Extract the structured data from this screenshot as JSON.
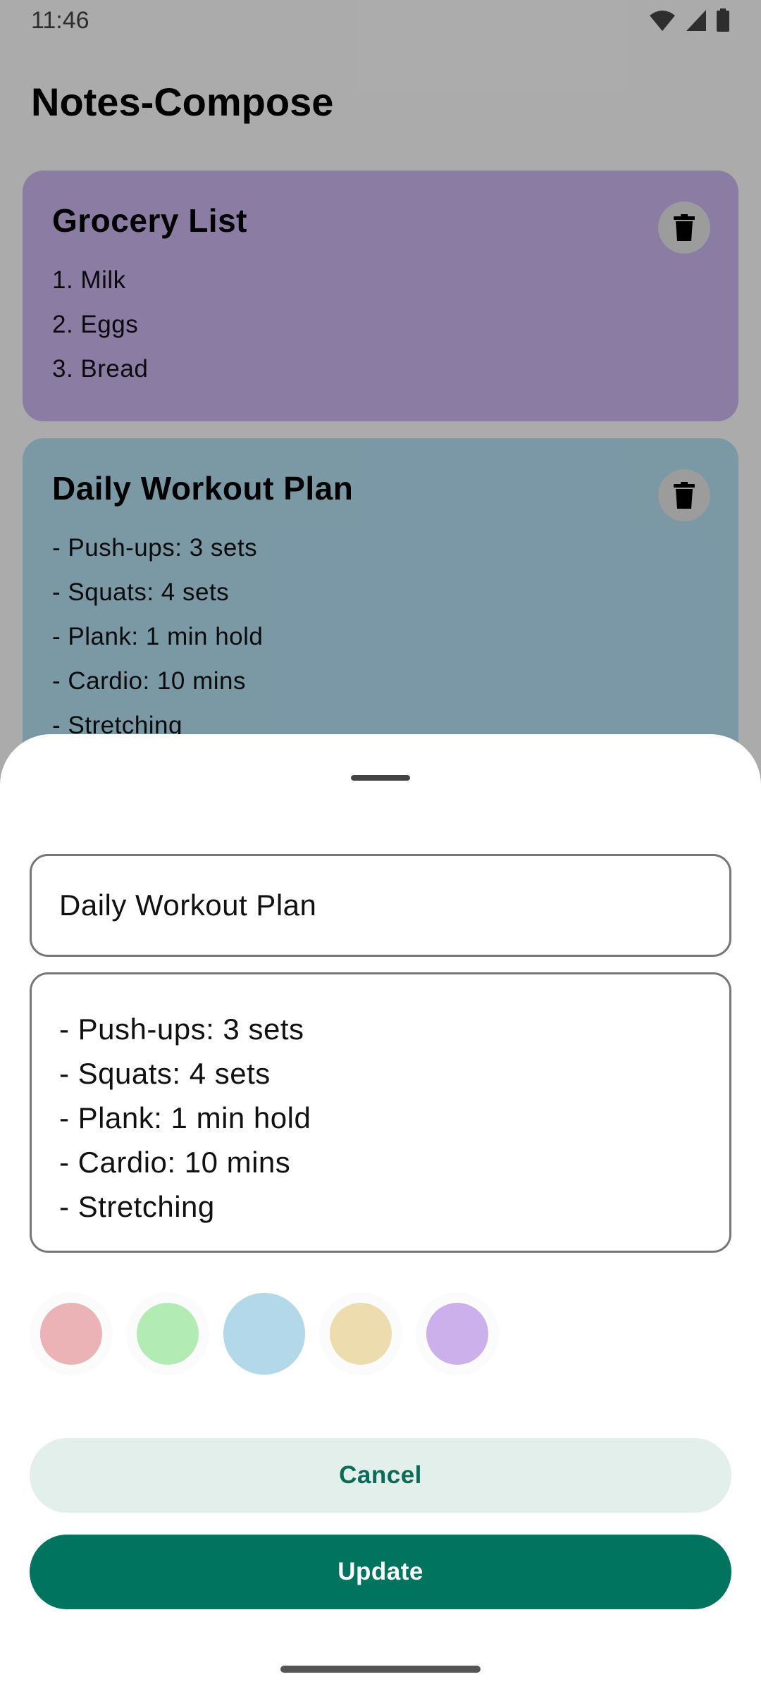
{
  "status_bar": {
    "time": "11:46"
  },
  "app": {
    "title": "Notes-Compose"
  },
  "notes": [
    {
      "title": "Grocery List",
      "lines": [
        "1. Milk",
        "2. Eggs",
        "3. Bread"
      ],
      "color": "#cdb7f0"
    },
    {
      "title": "Daily Workout Plan",
      "lines": [
        "- Push-ups: 3 sets",
        "- Squats: 4 sets",
        "- Plank: 1 min hold",
        "- Cardio: 10 mins",
        "- Stretching"
      ],
      "color": "#b5e0f4"
    }
  ],
  "sheet": {
    "title_value": "Daily Workout Plan",
    "body_lines": [
      "- Push-ups: 3 sets",
      "- Squats: 4 sets",
      "- Plank: 1 min hold",
      "- Cardio: 10 mins",
      "- Stretching"
    ],
    "colors": [
      {
        "name": "red",
        "hex": "#ecb3b6"
      },
      {
        "name": "green",
        "hex": "#b2ecb4"
      },
      {
        "name": "blue",
        "hex": "#b2d8ea",
        "selected": true
      },
      {
        "name": "yellow",
        "hex": "#ecdcae"
      },
      {
        "name": "purple",
        "hex": "#ccb0ec"
      }
    ],
    "cancel_label": "Cancel",
    "update_label": "Update"
  },
  "icons": {
    "delete": "trash-icon",
    "wifi": "wifi-icon",
    "signal": "signal-icon",
    "battery": "battery-icon"
  },
  "theme": {
    "primary": "#00745f",
    "primary_container": "#e3efeb"
  }
}
